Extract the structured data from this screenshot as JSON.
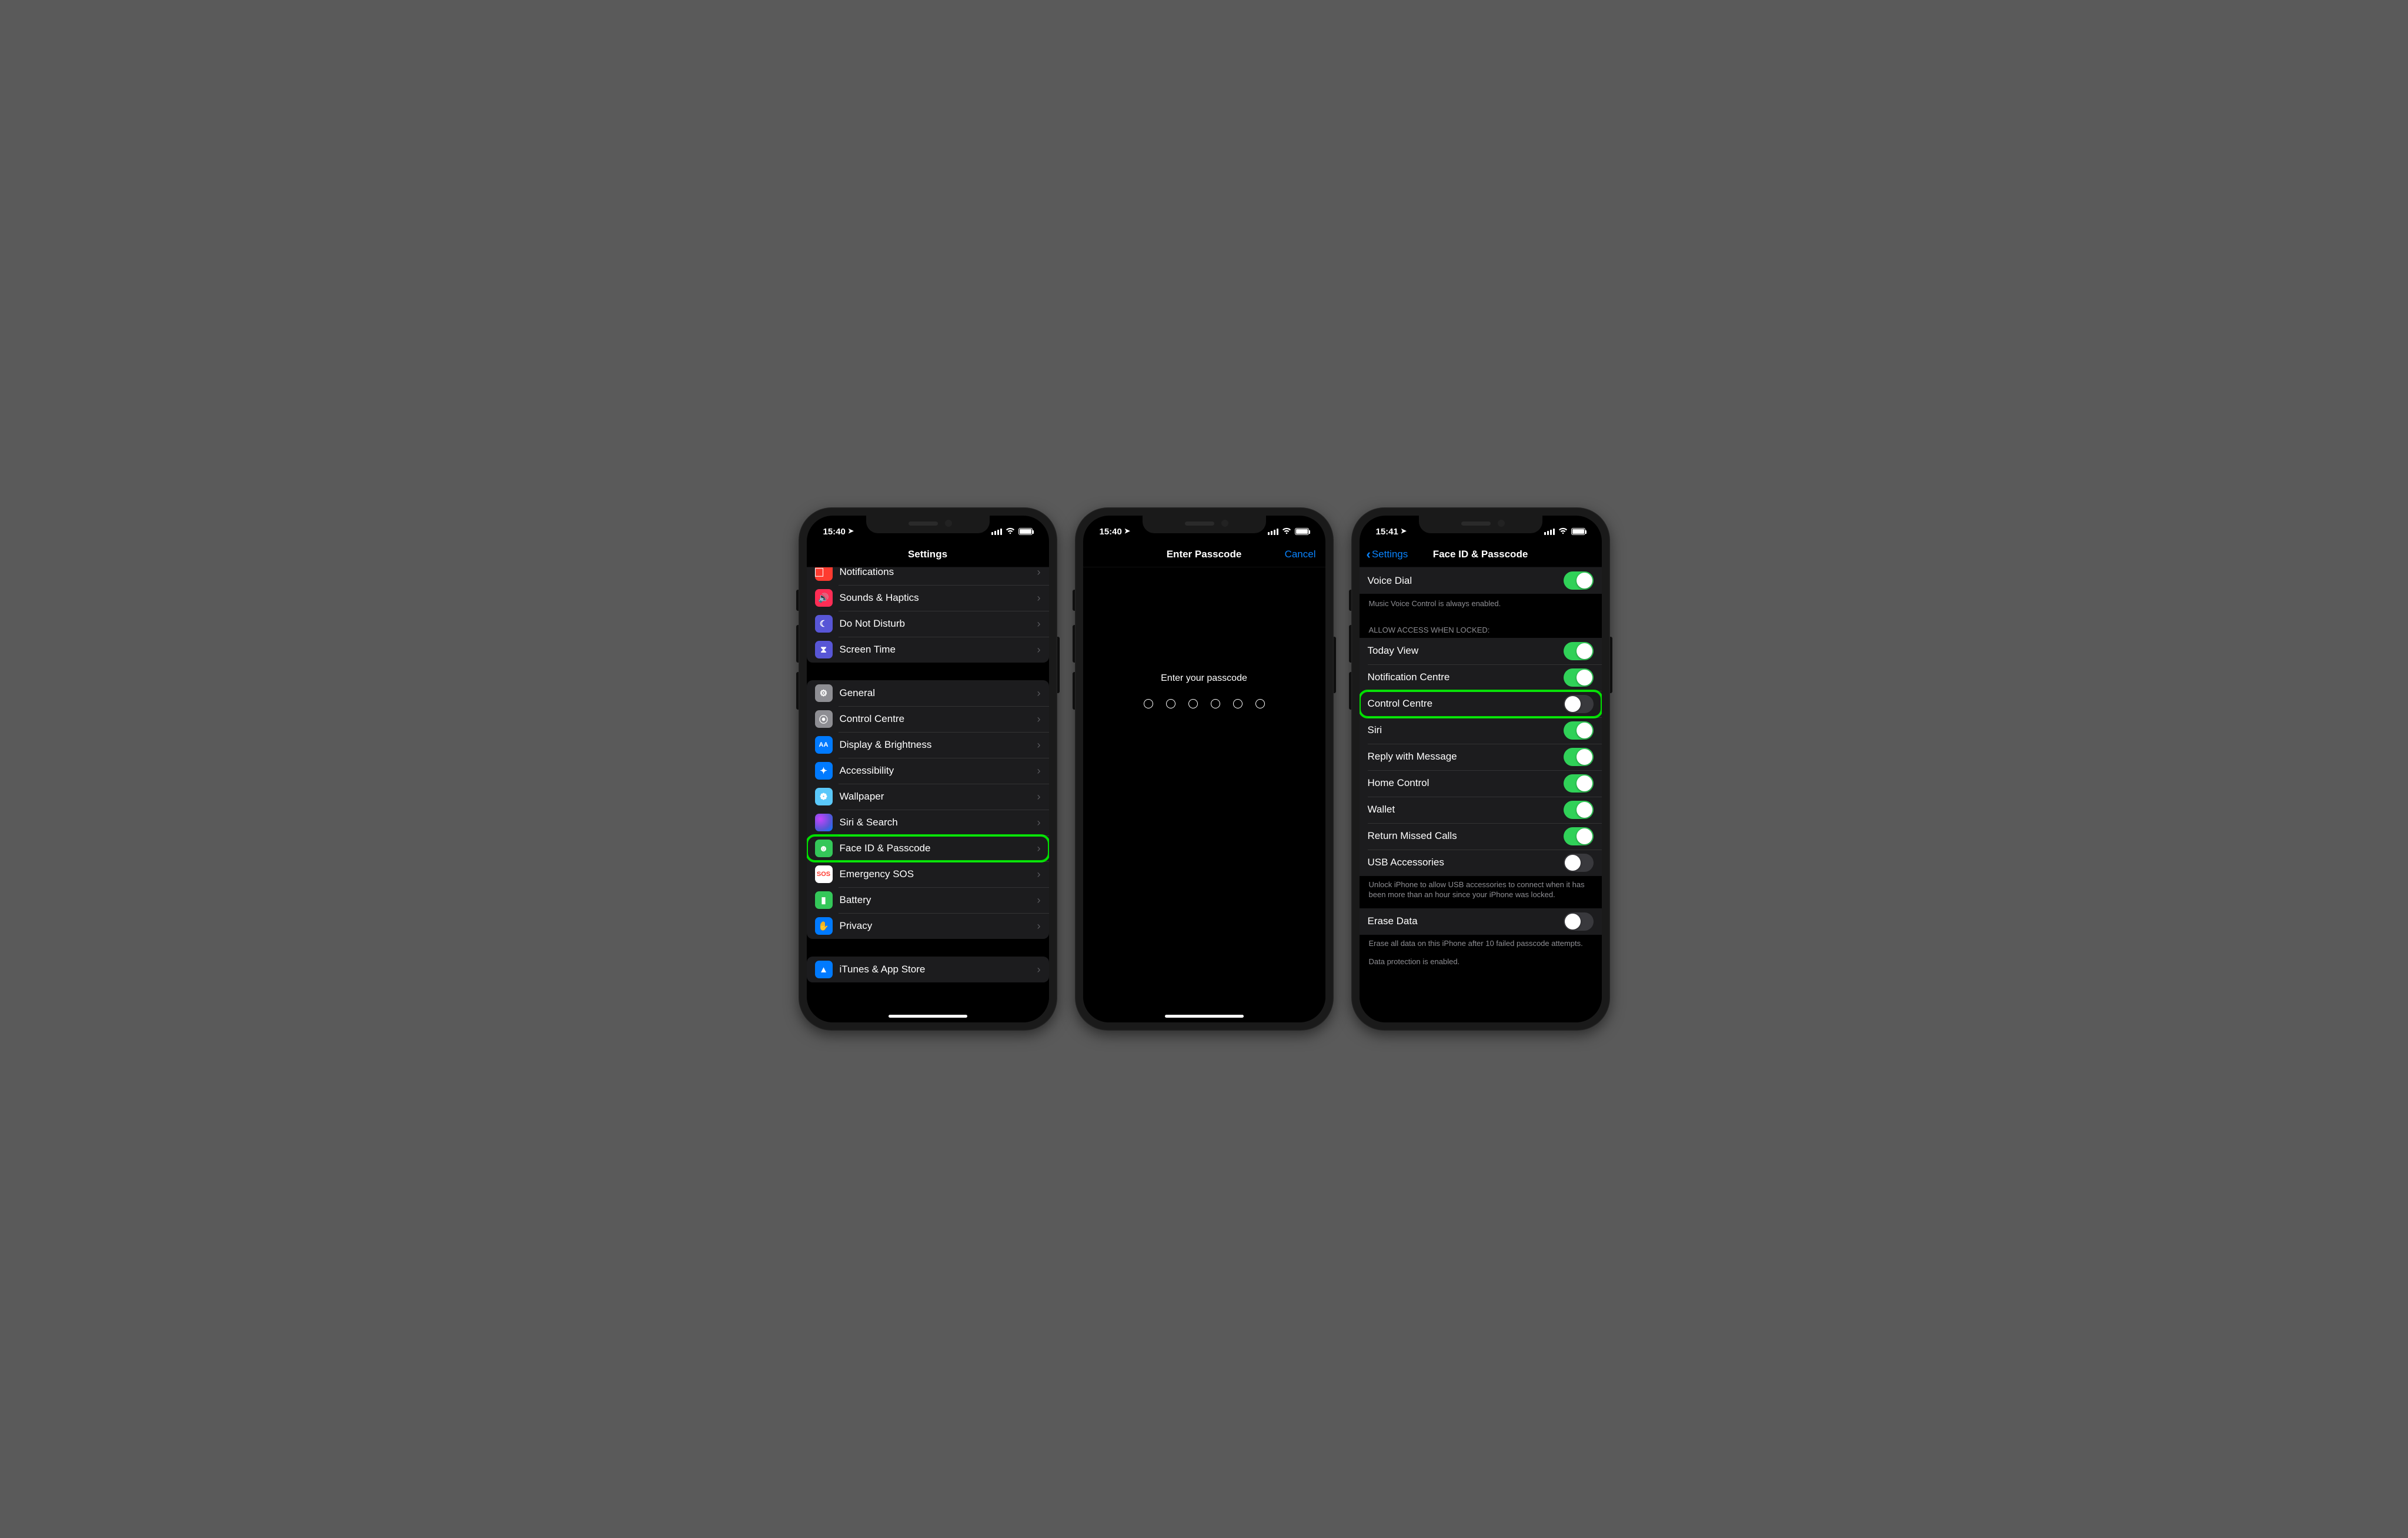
{
  "phone1": {
    "status": {
      "time": "15:40"
    },
    "nav": {
      "title": "Settings"
    },
    "group1": [
      {
        "label": "Notifications",
        "iconClass": "ic-red",
        "glyph": "⃞",
        "name": "row-notifications"
      },
      {
        "label": "Sounds & Haptics",
        "iconClass": "ic-pink",
        "glyph": "🔊",
        "name": "row-sounds-haptics"
      },
      {
        "label": "Do Not Disturb",
        "iconClass": "ic-purple",
        "glyph": "☾",
        "name": "row-do-not-disturb"
      },
      {
        "label": "Screen Time",
        "iconClass": "ic-hourglass",
        "glyph": "⧗",
        "name": "row-screen-time"
      }
    ],
    "group2": [
      {
        "label": "General",
        "iconClass": "ic-gray",
        "glyph": "⚙",
        "name": "row-general"
      },
      {
        "label": "Control Centre",
        "iconClass": "ic-cc",
        "glyph": "⦿",
        "name": "row-control-centre"
      },
      {
        "label": "Display & Brightness",
        "iconClass": "ic-blue",
        "glyph": "AA",
        "glyphSize": "11px",
        "name": "row-display-brightness"
      },
      {
        "label": "Accessibility",
        "iconClass": "ic-bluebright",
        "glyph": "✦",
        "name": "row-accessibility"
      },
      {
        "label": "Wallpaper",
        "iconClass": "ic-cyan",
        "glyph": "❁",
        "name": "row-wallpaper"
      },
      {
        "label": "Siri & Search",
        "iconClass": "ic-siri",
        "glyph": "",
        "name": "row-siri-search"
      },
      {
        "label": "Face ID & Passcode",
        "iconClass": "ic-faceid",
        "glyph": "☻",
        "highlight": true,
        "name": "row-faceid-passcode"
      },
      {
        "label": "Emergency SOS",
        "iconClass": "ic-sos",
        "glyph": "SOS",
        "name": "row-emergency-sos"
      },
      {
        "label": "Battery",
        "iconClass": "ic-battery",
        "glyph": "▮",
        "name": "row-battery"
      },
      {
        "label": "Privacy",
        "iconClass": "ic-bluebright",
        "glyph": "✋",
        "name": "row-privacy"
      }
    ],
    "group3": [
      {
        "label": "iTunes & App Store",
        "iconClass": "ic-appstore",
        "glyph": "▲",
        "name": "row-itunes-appstore"
      }
    ]
  },
  "phone2": {
    "status": {
      "time": "15:40"
    },
    "nav": {
      "title": "Enter Passcode",
      "rightAction": "Cancel"
    },
    "prompt": "Enter your passcode",
    "digits": 6
  },
  "phone3": {
    "status": {
      "time": "15:41"
    },
    "nav": {
      "title": "Face ID & Passcode",
      "back": "Settings"
    },
    "voiceDial": {
      "label": "Voice Dial",
      "on": true
    },
    "voiceDialFooter": "Music Voice Control is always enabled.",
    "allowHeader": "ALLOW ACCESS WHEN LOCKED:",
    "allow": [
      {
        "label": "Today View",
        "on": true,
        "name": "toggle-today-view"
      },
      {
        "label": "Notification Centre",
        "on": true,
        "name": "toggle-notification-centre"
      },
      {
        "label": "Control Centre",
        "on": false,
        "highlight": true,
        "name": "toggle-control-centre"
      },
      {
        "label": "Siri",
        "on": true,
        "name": "toggle-siri"
      },
      {
        "label": "Reply with Message",
        "on": true,
        "name": "toggle-reply-with-message"
      },
      {
        "label": "Home Control",
        "on": true,
        "name": "toggle-home-control"
      },
      {
        "label": "Wallet",
        "on": true,
        "name": "toggle-wallet"
      },
      {
        "label": "Return Missed Calls",
        "on": true,
        "name": "toggle-return-missed-calls"
      },
      {
        "label": "USB Accessories",
        "on": false,
        "name": "toggle-usb-accessories"
      }
    ],
    "usbFooter": "Unlock iPhone to allow USB accessories to connect when it has been more than an hour since your iPhone was locked.",
    "erase": {
      "label": "Erase Data",
      "on": false
    },
    "eraseFooter": "Erase all data on this iPhone after 10 failed passcode attempts.",
    "dataProtection": "Data protection is enabled."
  }
}
